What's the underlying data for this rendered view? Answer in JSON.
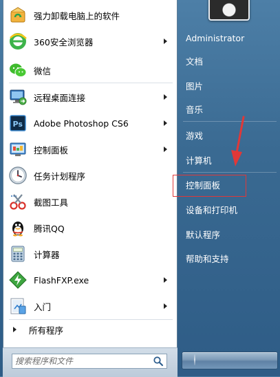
{
  "programs": [
    {
      "label": "强力卸载电脑上的软件",
      "icon": "uninstaller-icon",
      "has_submenu": false
    },
    {
      "label": "360安全浏览器",
      "icon": "360-browser-icon",
      "has_submenu": true
    },
    {
      "label": "微信",
      "icon": "wechat-icon",
      "has_submenu": false
    },
    {
      "label": "远程桌面连接",
      "icon": "remote-desktop-icon",
      "has_submenu": true
    },
    {
      "label": "Adobe Photoshop CS6",
      "icon": "photoshop-icon",
      "has_submenu": true
    },
    {
      "label": "控制面板",
      "icon": "control-panel-icon",
      "has_submenu": true
    },
    {
      "label": "任务计划程序",
      "icon": "task-scheduler-icon",
      "has_submenu": false
    },
    {
      "label": "截图工具",
      "icon": "snipping-tool-icon",
      "has_submenu": false
    },
    {
      "label": "腾讯QQ",
      "icon": "qq-icon",
      "has_submenu": false
    },
    {
      "label": "计算器",
      "icon": "calculator-icon",
      "has_submenu": false
    },
    {
      "label": "FlashFXP.exe",
      "icon": "flashfxp-icon",
      "has_submenu": true
    },
    {
      "label": "入门",
      "icon": "getting-started-icon",
      "has_submenu": true
    }
  ],
  "all_programs_label": "所有程序",
  "search": {
    "placeholder": "搜索程序和文件"
  },
  "right_panel": {
    "username": "Administrator",
    "items": [
      "文档",
      "图片",
      "音乐",
      "游戏",
      "计算机",
      "控制面板",
      "设备和打印机",
      "默认程序",
      "帮助和支持"
    ],
    "highlighted_item": "控制面板"
  },
  "colors": {
    "menu_background": "#3a6a92",
    "highlight_border": "#e03838",
    "arrow": "#e03838"
  }
}
